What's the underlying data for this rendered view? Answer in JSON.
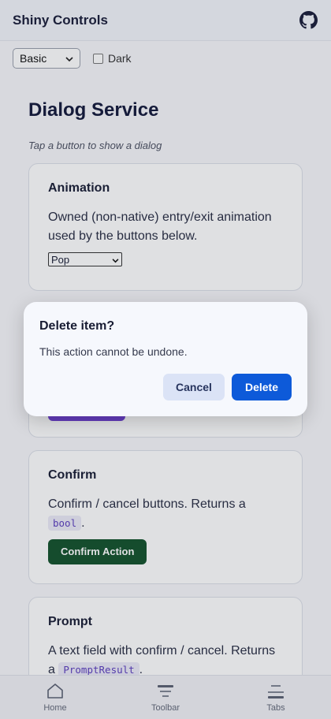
{
  "header": {
    "title": "Shiny Controls",
    "github_icon": "github-icon"
  },
  "controls": {
    "theme_select": {
      "value": "Basic",
      "icon": "chevron-down-icon"
    },
    "dark_label": "Dark",
    "dark_checked": false
  },
  "page": {
    "heading": "Dialog Service",
    "hint": "Tap a button to show a dialog"
  },
  "cards": {
    "animation": {
      "title": "Animation",
      "text": "Owned (non-native) entry/exit animation used by the buttons below.",
      "select_value": "Pop"
    },
    "confirm": {
      "title": "Confirm",
      "text_before": "Confirm / cancel buttons. Returns a",
      "code": "bool",
      "text_after": ".",
      "button_label": "Confirm Action"
    },
    "prompt": {
      "title": "Prompt",
      "text_before": "A text field with confirm / cancel. Returns a",
      "code": "PromptResult",
      "text_after": "."
    }
  },
  "dialog": {
    "title": "Delete item?",
    "message": "This action cannot be undone.",
    "cancel_label": "Cancel",
    "delete_label": "Delete"
  },
  "tabs": [
    {
      "label": "Home",
      "icon": "home-icon"
    },
    {
      "label": "Toolbar",
      "icon": "toolbar-icon"
    },
    {
      "label": "Tabs",
      "icon": "tabs-icon"
    }
  ],
  "colors": {
    "primary": "#0d5ad9",
    "confirm_green": "#14532d",
    "accent_purple": "#6d3fd0"
  }
}
